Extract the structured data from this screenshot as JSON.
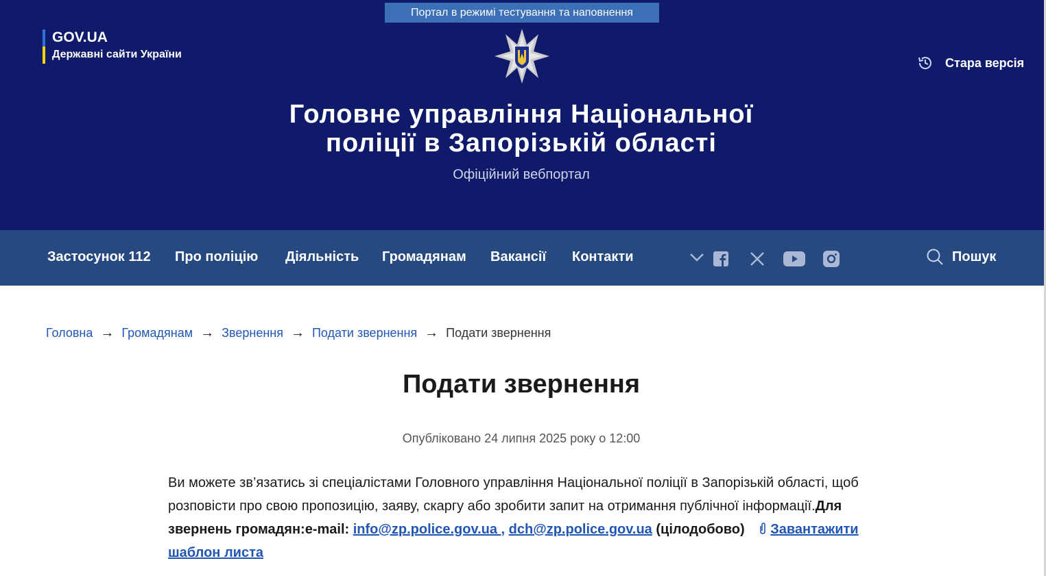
{
  "header": {
    "test_banner": "Портал в режимі тестування та наповнення",
    "gov_title": "GOV.UA",
    "gov_subtitle": "Державні сайти України",
    "old_version": "Стара версія",
    "site_title_line1": "Головне управління Національної",
    "site_title_line2": "поліції в Запорізькій області",
    "site_subtitle": "Офіційний вебпортал"
  },
  "nav": {
    "items": [
      "Застосунок 112",
      "Про поліцію",
      "Діяльність",
      "Громадянам",
      "Вакансії",
      "Контакти"
    ],
    "search_label": "Пошук",
    "social_icons": [
      "facebook-icon",
      "x-icon",
      "youtube-icon",
      "instagram-icon"
    ]
  },
  "breadcrumb": {
    "items": [
      "Головна",
      "Громадянам",
      "Звернення",
      "Подати звернення"
    ],
    "current": "Подати звернення"
  },
  "content": {
    "title": "Подати звернення",
    "published": "Опубліковано 24 липня 2025 року о 12:00",
    "paragraph_text": "Ви можете зв’язатись зі спеціалістами Головного управління Національної поліції в Запорізькій області, щоб розповісти про свою пропозицію, заяву, скаргу або зробити запит на отримання публічної інформації.",
    "bold_label": "Для звернень громадян:e-mail:",
    "email1": "info@zp.police.gov.ua ,",
    "email2": "dch@zp.police.gov.ua",
    "hours": "(цілодобово)",
    "download_link": "Завантажити шаблон листа"
  },
  "colors": {
    "header_bg": "#0f1a6b",
    "nav_bg": "#264980",
    "banner_bg": "#3b6fb6",
    "link": "#2156b4"
  }
}
